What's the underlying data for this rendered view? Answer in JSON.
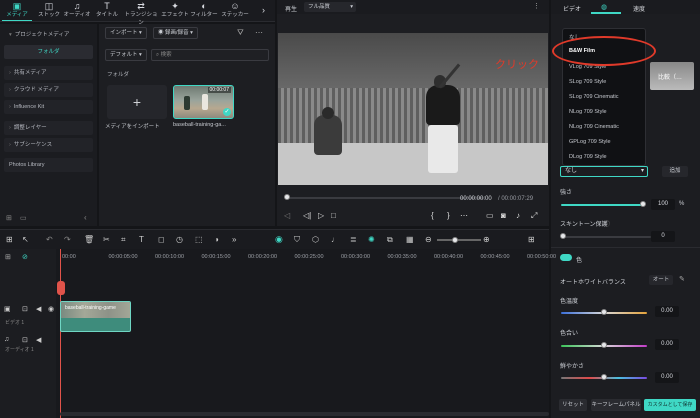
{
  "toolbar": {
    "tools": [
      {
        "label": "メディア",
        "icon": "media-icon"
      },
      {
        "label": "ストック",
        "icon": "stock-icon"
      },
      {
        "label": "オーディオ",
        "icon": "audio-icon"
      },
      {
        "label": "タイトル",
        "icon": "title-icon"
      },
      {
        "label": "トランジション",
        "icon": "transition-icon"
      },
      {
        "label": "エフェクト",
        "icon": "effect-icon"
      },
      {
        "label": "フィルター",
        "icon": "filter-icon"
      },
      {
        "label": "ステッカー",
        "icon": "sticker-icon"
      }
    ]
  },
  "sidebar": {
    "project_media": "プロジェクトメディア",
    "folder": "フォルダ",
    "items": [
      "共有メディア",
      "クラウド メディア",
      "Influence Kit",
      "調整レイヤー",
      "サブシーケンス",
      "Photos Library"
    ]
  },
  "media": {
    "import_label": "インポート",
    "record_label": "録画/録音",
    "default_label": "デフォルト",
    "search_placeholder": "検索",
    "folder_label": "フォルダ",
    "import_tile_label": "メディアをインポート",
    "clip_name": "baseball-training-ga...",
    "clip_duration": "00:00:07"
  },
  "preview": {
    "playback_label": "再生",
    "quality_label": "フル品質",
    "current_time": "00:00:00:00",
    "total_time": "/ 00:00:07:29",
    "annotation": "クリック"
  },
  "right_panel": {
    "tabs": [
      "ビデオ",
      "",
      "速度"
    ],
    "thumb_label": "比較（…",
    "dropdown_items": [
      "なし",
      "B&W Film",
      "VLog 709 Style",
      "SLog 709 Style",
      "SLog 709 Cinematic",
      "NLog 709 Style",
      "NLog 709 Cinematic",
      "GPLog 709 Style",
      "DLog 709 Style"
    ],
    "lut_select_value": "なし",
    "add_label": "追加",
    "strength_label": "強さ",
    "strength_value": "100",
    "strength_unit": "%",
    "skin_label": "スキントーン保護",
    "skin_value": "0",
    "color_section": "色",
    "white_balance_label": "オートホワイトバランス",
    "auto_label": "オート",
    "temperature_label": "色温度",
    "temperature_value": "0.00",
    "tint_label": "色合い",
    "tint_value": "0.00",
    "vibrance_label": "鮮やかさ",
    "vibrance_value": "0.00",
    "reset_label": "リセット",
    "keyframe_label": "キーフレームパネル",
    "save_custom_label": "カスタムとして保存",
    "strength_level": 100,
    "temperature_level": 0.5,
    "tint_level": 0.5,
    "vibrance_level": 0.5
  },
  "timeline": {
    "ticks": [
      "00:00",
      "00:00:05:00",
      "00:00:10:00",
      "00:00:15:00",
      "00:00:20:00",
      "00:00:25:00",
      "00:00:30:00",
      "00:00:35:00",
      "00:00:40:00",
      "00:00:45:00",
      "00:00:50:00"
    ],
    "video_track_label": "ビデオ 1",
    "audio_track_label": "オーディオ 1",
    "clip_label": "baseball-training-game"
  },
  "colors": {
    "accent": "#3fd8c5",
    "annotation_red": "#e03a2a",
    "playhead": "#e0534a"
  }
}
